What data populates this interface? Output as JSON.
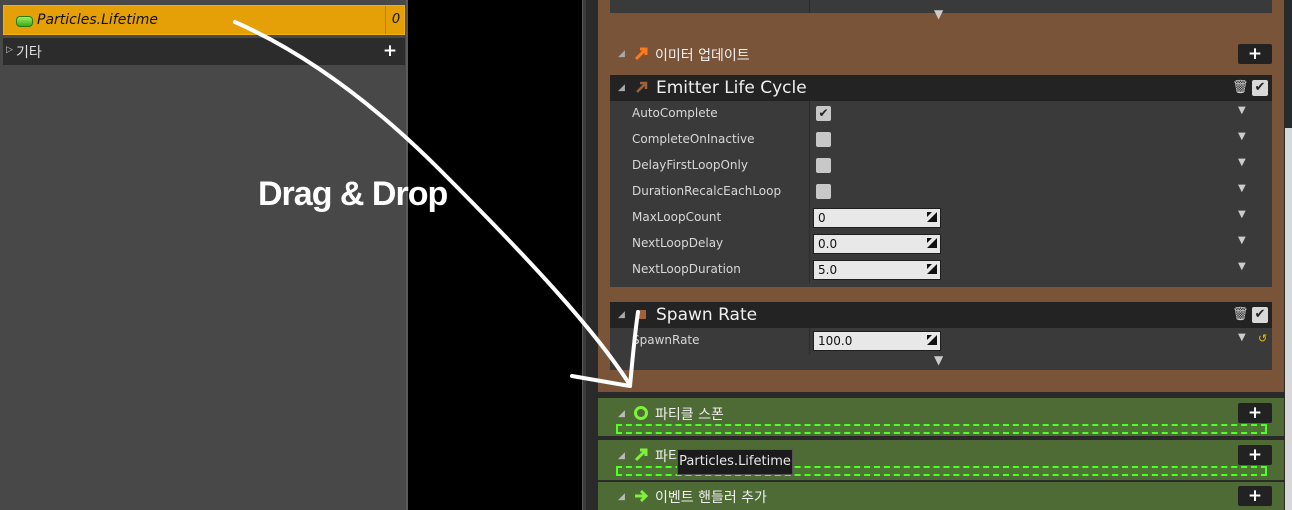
{
  "left_panel": {
    "parameter": {
      "name": "Particles.Lifetime",
      "value": "0"
    },
    "misc_section": {
      "label": "기타"
    }
  },
  "update_stage": {
    "title": "이미터 업데이트",
    "modules": [
      {
        "title": "Emitter Life Cycle",
        "properties": [
          {
            "label": "AutoComplete",
            "type": "checkbox",
            "checked": true
          },
          {
            "label": "CompleteOnInactive",
            "type": "checkbox",
            "checked": false
          },
          {
            "label": "DelayFirstLoopOnly",
            "type": "checkbox",
            "checked": false
          },
          {
            "label": "DurationRecalcEachLoop",
            "type": "checkbox",
            "checked": false
          },
          {
            "label": "MaxLoopCount",
            "type": "number",
            "value": "0"
          },
          {
            "label": "NextLoopDelay",
            "type": "number",
            "value": "0.0"
          },
          {
            "label": "NextLoopDuration",
            "type": "number",
            "value": "5.0"
          }
        ]
      },
      {
        "title": "Spawn Rate",
        "properties": [
          {
            "label": "SpawnRate",
            "type": "number",
            "value": "100.0"
          }
        ]
      }
    ]
  },
  "green_stages": [
    {
      "title": "파티클 스폰"
    },
    {
      "title": "파티"
    },
    {
      "title": "이벤트 핸들러 추가"
    }
  ],
  "tooltip": "Particles.Lifetime",
  "annotation": "Drag & Drop",
  "colors": {
    "parameter_highlight": "#e5a008",
    "update_stage": "#7a5438",
    "spawn_stage": "#4e6b35",
    "drop_target": "#4eff2a"
  }
}
